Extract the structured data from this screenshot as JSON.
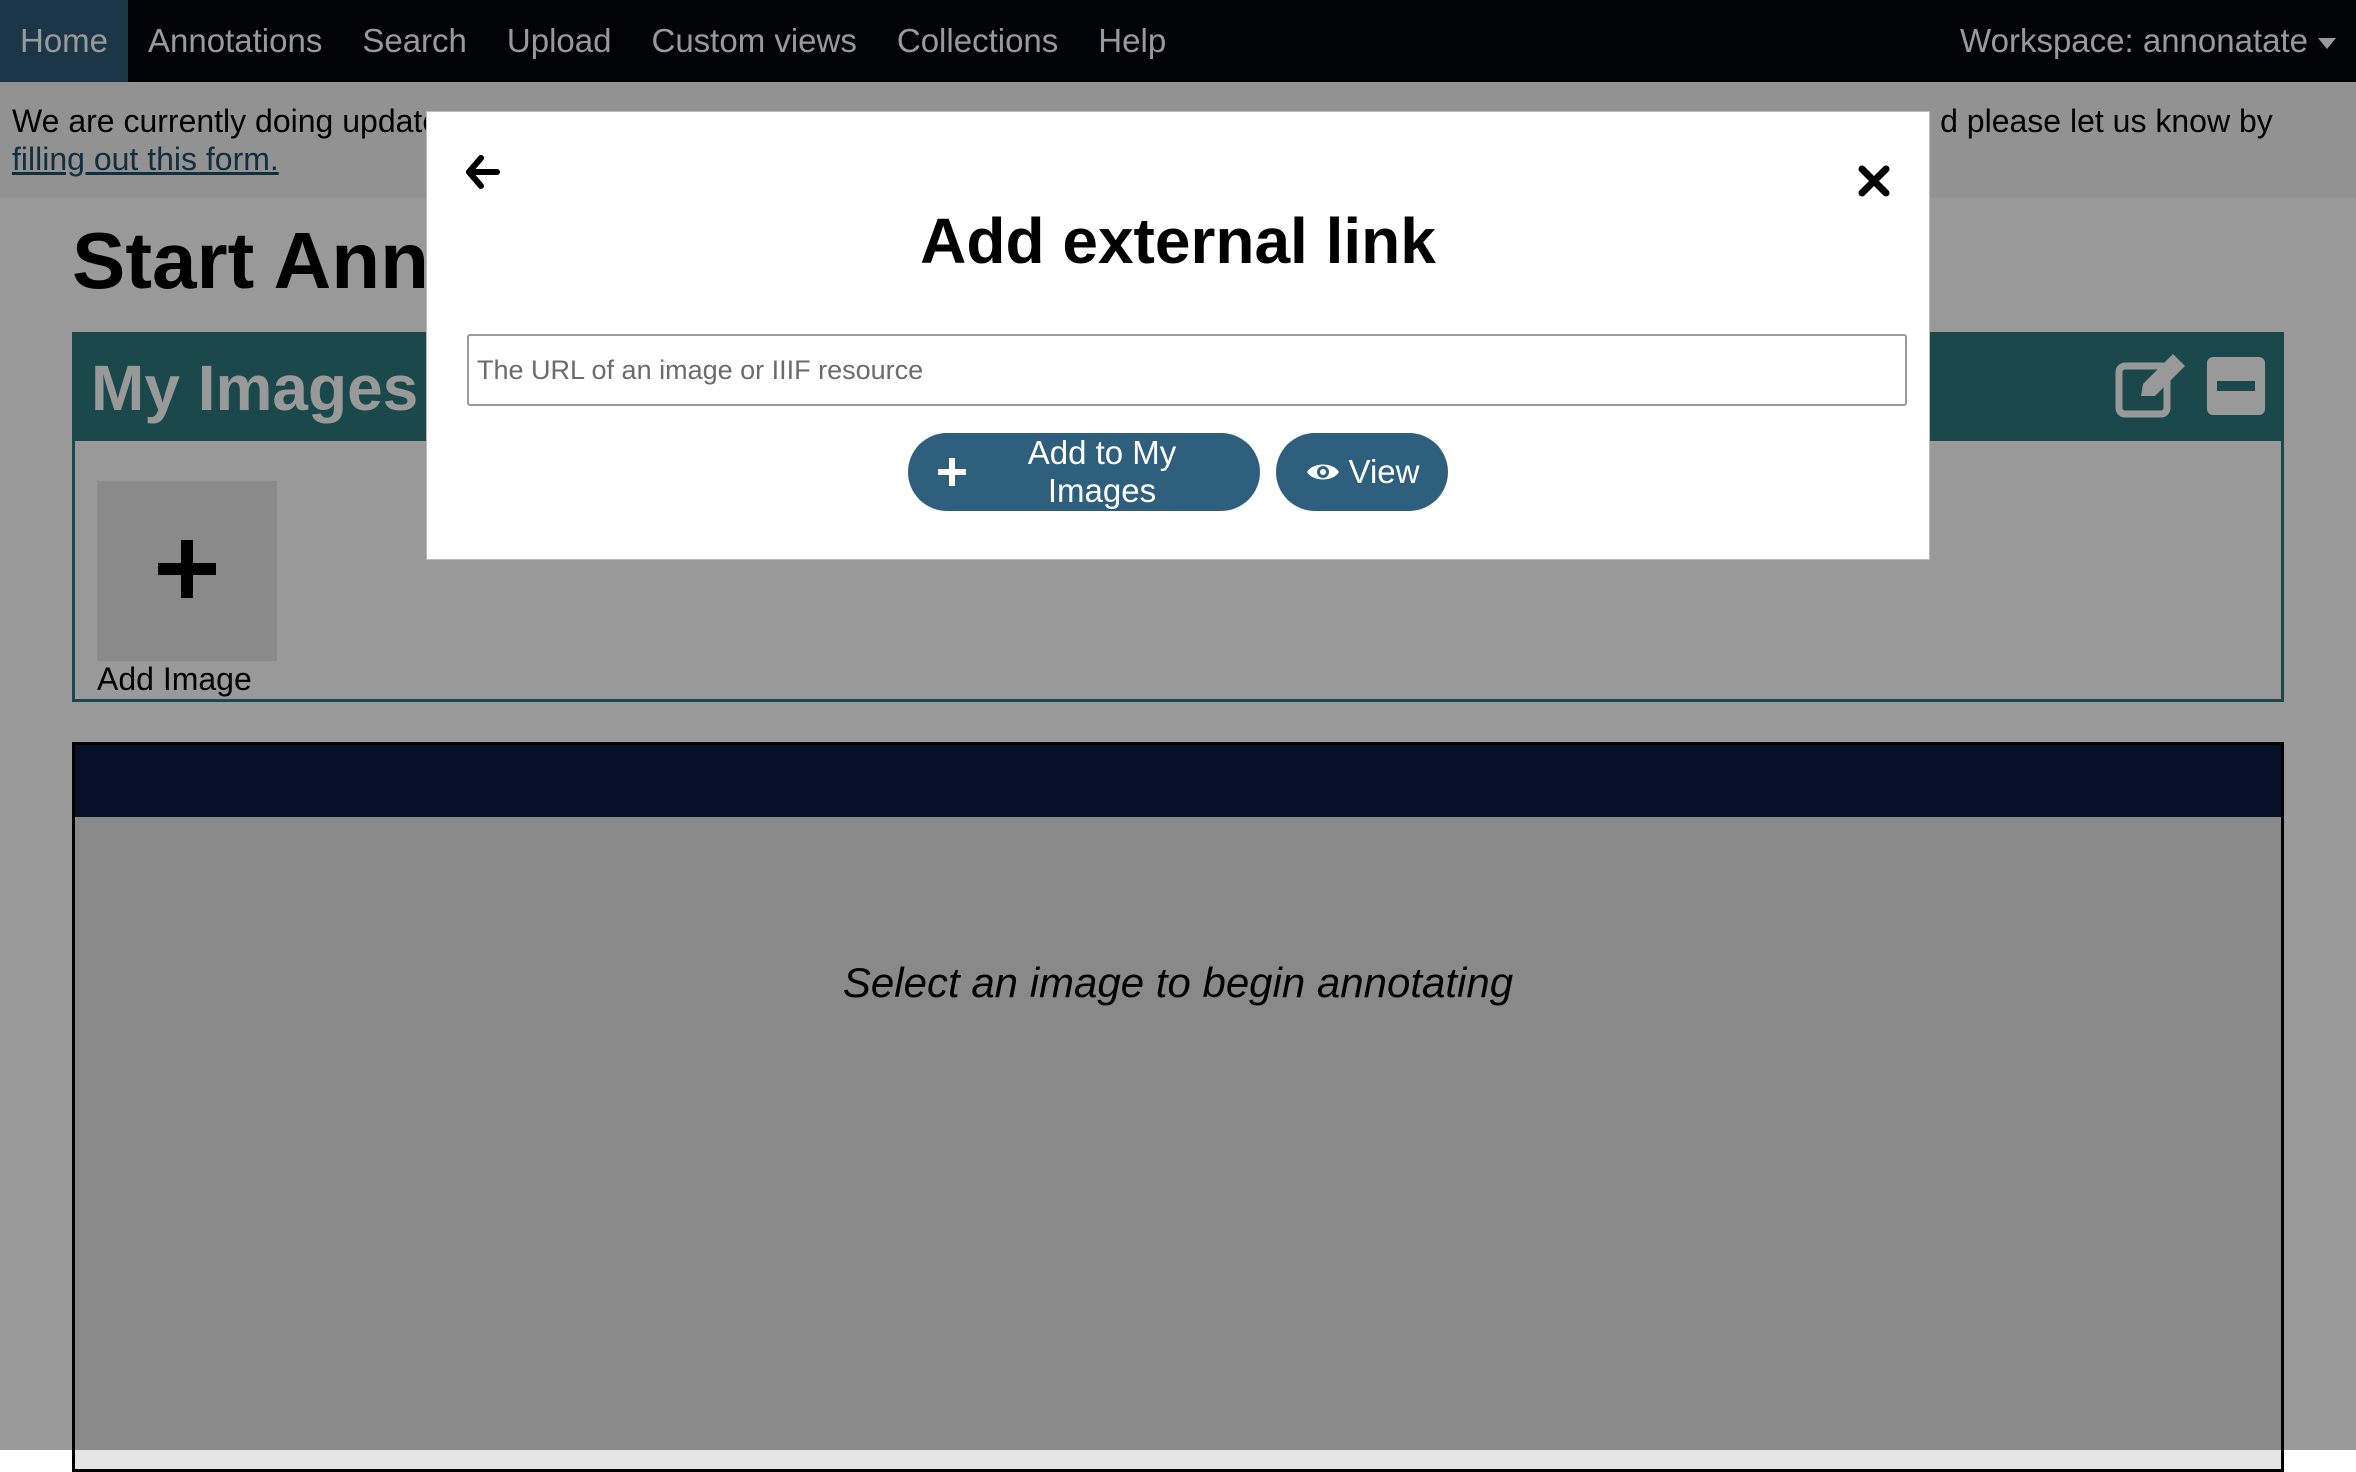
{
  "nav": {
    "items": [
      {
        "label": "Home",
        "active": true
      },
      {
        "label": "Annotations",
        "active": false
      },
      {
        "label": "Search",
        "active": false
      },
      {
        "label": "Upload",
        "active": false
      },
      {
        "label": "Custom views",
        "active": false
      },
      {
        "label": "Collections",
        "active": false
      },
      {
        "label": "Help",
        "active": false
      }
    ],
    "workspace_label": "Workspace: annonatate",
    "workspace_icon": "caret-down-icon"
  },
  "banner": {
    "text": "We are currently doing updates to the application and some parts of the site... If you would like to help or find something broken please let us know by",
    "visible_text_start": "We are currently doing update",
    "visible_text_end": "d please let us know by",
    "link_text": "filling out this form."
  },
  "page": {
    "title": "Start Anno"
  },
  "my_images": {
    "title": "My Images",
    "edit_icon": "edit-icon",
    "collapse_icon": "minus-icon",
    "add_tile_label": "Add Image",
    "add_tile_icon": "plus-icon"
  },
  "annotation_panel": {
    "message": "Select an image to begin annotating"
  },
  "modal": {
    "back_icon": "arrow-left-icon",
    "close_icon": "close-icon",
    "title": "Add external link",
    "url_placeholder": "The URL of an image or IIIF resource",
    "url_value": "",
    "add_button_label": "Add to My Images",
    "add_button_icon": "plus-icon",
    "view_button_label": "View",
    "view_button_icon": "eye-icon"
  },
  "colors": {
    "navbar_bg": "#03050d",
    "nav_active_bg": "#2e5a76",
    "panel_teal": "#2e7a7e",
    "annotation_header": "#0b1d44",
    "button_bg": "#2e5f7d",
    "overlay": "rgba(0,0,0,0.4)"
  }
}
